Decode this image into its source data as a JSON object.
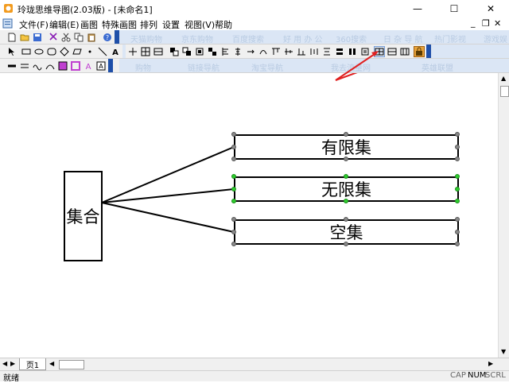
{
  "window": {
    "title": "玲珑思维导图(2.03版) - [未命名1]",
    "minimize": "—",
    "maximize": "☐",
    "close": "✕"
  },
  "menu": {
    "items": [
      "文件(F)",
      "编辑(E)",
      "画图",
      "特殊画图",
      "排列",
      "设置",
      "视图(V)",
      "帮助"
    ],
    "mdi_controls": [
      "_",
      "❐",
      "✕"
    ]
  },
  "ghost_links": {
    "row1": [
      "天猫购物",
      "京东购物",
      "百度搜索",
      "好 用 办 公",
      "360搜索",
      "日 杂 导 航",
      "热门影视",
      "游戏娱"
    ],
    "row2": [
      "购物",
      "链接导航",
      "淘宝导航",
      "我去流量网",
      "英雄联盟"
    ]
  },
  "diagram": {
    "root": "集合",
    "children": [
      {
        "label": "有限集",
        "selected": false
      },
      {
        "label": "无限集",
        "selected": true
      },
      {
        "label": "空集",
        "selected": false
      }
    ],
    "line_color": "#000000",
    "selection_color": "#2ecc2e",
    "handle_color": "#888888"
  },
  "annotation": {
    "arrow_color": "#e02020"
  },
  "tabs": {
    "page1": "页1"
  },
  "status": {
    "text": "就绪",
    "cap": "CAP",
    "num": "NUM",
    "scrl": "SCRL"
  }
}
